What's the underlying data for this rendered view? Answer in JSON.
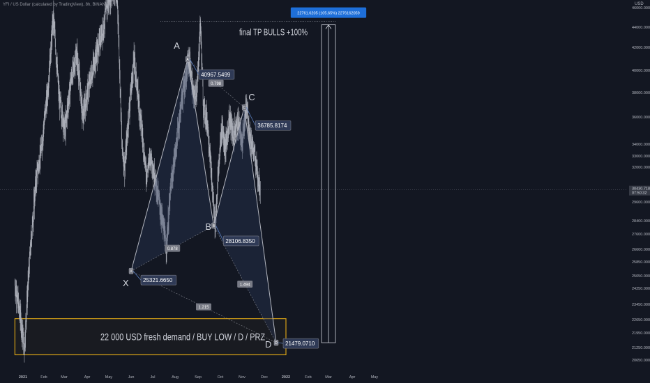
{
  "header": {
    "symbol_title": "YFI / US Dollar (calculated by TradingView), 8h, BINANCE",
    "currency": "USD"
  },
  "measure_label": "22761.6205 (105.65%) 2276162059",
  "chart_data": {
    "type": "candlestick",
    "title": "",
    "colors": {
      "background": "#131722",
      "candles": "#b2b5be",
      "pattern": "#b2b5be",
      "pattern_fill": "#2a3a5c",
      "zone_border": "#d4a017",
      "measure_label_bg": "#1e6fd9",
      "price_label_bg": "#2f3a56",
      "price_label_border": "#787b86"
    },
    "y_axis": {
      "min": 20000,
      "max": 46000,
      "ticks": [
        20650,
        21250,
        21950,
        22650,
        23450,
        24250,
        25050,
        25850,
        26600,
        27600,
        28400,
        29600,
        32000,
        33000,
        34000,
        36000,
        38000,
        40000,
        42000,
        44000,
        46000
      ],
      "tick_labels": [
        "20650.0000",
        "21250.0000",
        "21950.0000",
        "22650.0000",
        "23450.0000",
        "24250.0000",
        "25050.0000",
        "25850.0000",
        "26600.0000",
        "27600.0000",
        "28400.0000",
        "29600.0000",
        "32000.0000",
        "33000.0000",
        "34000.0000",
        "36000.0000",
        "38000.0000",
        "40000.0000",
        "42000.0000",
        "44000.0000",
        "46000.0000"
      ],
      "current_price": 30430.7183,
      "current_price_label": "30430.7183",
      "countdown_label": "07:50:32"
    },
    "x_axis": {
      "labels": [
        "2021",
        "Feb",
        "Mar",
        "Apr",
        "May",
        "Jun",
        "Jul",
        "Aug",
        "Sep",
        "Oct",
        "Nov",
        "Dec",
        "2022",
        "Feb",
        "Mar",
        "Apr",
        "May"
      ],
      "dates": [
        "2021-01-01",
        "2021-02-01",
        "2021-03-01",
        "2021-04-01",
        "2021-05-01",
        "2021-06-01",
        "2021-07-01",
        "2021-08-01",
        "2021-09-01",
        "2021-10-01",
        "2021-11-01",
        "2021-12-01",
        "2022-01-01",
        "2022-02-01",
        "2022-03-01",
        "2022-04-01",
        "2022-05-01"
      ]
    },
    "price_path": [
      [
        "2020-12-20",
        24500
      ],
      [
        "2020-12-28",
        22800
      ],
      [
        "2021-01-03",
        21200
      ],
      [
        "2021-01-10",
        25500
      ],
      [
        "2021-01-20",
        31000
      ],
      [
        "2021-01-28",
        33500
      ],
      [
        "2021-02-06",
        38000
      ],
      [
        "2021-02-14",
        45000
      ],
      [
        "2021-02-22",
        37500
      ],
      [
        "2021-03-02",
        35000
      ],
      [
        "2021-03-10",
        39000
      ],
      [
        "2021-03-18",
        41500
      ],
      [
        "2021-03-26",
        36000
      ],
      [
        "2021-04-03",
        38500
      ],
      [
        "2021-04-12",
        41000
      ],
      [
        "2021-04-22",
        43500
      ],
      [
        "2021-05-01",
        47000
      ],
      [
        "2021-05-08",
        48000
      ],
      [
        "2021-05-13",
        46500
      ],
      [
        "2021-05-19",
        34000
      ],
      [
        "2021-05-23",
        32000
      ],
      [
        "2021-05-29",
        36500
      ],
      [
        "2021-06-05",
        41000
      ],
      [
        "2021-06-10",
        38000
      ],
      [
        "2021-06-15",
        35500
      ],
      [
        "2021-06-22",
        31500
      ],
      [
        "2021-06-28",
        33000
      ],
      [
        "2021-07-05",
        31000
      ],
      [
        "2021-07-12",
        29000
      ],
      [
        "2021-07-20",
        26800
      ],
      [
        "2021-07-26",
        30500
      ],
      [
        "2021-08-02",
        33500
      ],
      [
        "2021-08-10",
        37500
      ],
      [
        "2021-08-16",
        39500
      ],
      [
        "2021-08-20",
        41000
      ],
      [
        "2021-08-26",
        37500
      ],
      [
        "2021-08-31",
        38500
      ],
      [
        "2021-09-04",
        44500
      ],
      [
        "2021-09-08",
        37000
      ],
      [
        "2021-09-14",
        35500
      ],
      [
        "2021-09-20",
        30500
      ],
      [
        "2021-09-24",
        28100
      ],
      [
        "2021-09-28",
        31500
      ],
      [
        "2021-10-03",
        35500
      ],
      [
        "2021-10-08",
        33500
      ],
      [
        "2021-10-14",
        36000
      ],
      [
        "2021-10-20",
        34500
      ],
      [
        "2021-10-26",
        35800
      ],
      [
        "2021-11-01",
        34000
      ],
      [
        "2021-11-07",
        36800
      ],
      [
        "2021-11-12",
        34500
      ],
      [
        "2021-11-18",
        33000
      ],
      [
        "2021-11-22",
        31500
      ],
      [
        "2021-11-26",
        30400
      ]
    ],
    "pattern": {
      "name": "XABCD",
      "points": [
        {
          "label": "X",
          "date": "2021-06-01",
          "price": 25321.665,
          "price_label": "25321.6650"
        },
        {
          "label": "A",
          "date": "2021-08-18",
          "price": 40967.5499,
          "price_label": "40967.5499"
        },
        {
          "label": "B",
          "date": "2021-09-22",
          "price": 28106.835,
          "price_label": "28106.8350"
        },
        {
          "label": "C",
          "date": "2021-11-04",
          "price": 36785.8174,
          "price_label": "36785.8174"
        },
        {
          "label": "D",
          "date": "2021-12-18",
          "price": 21479.071,
          "price_label": "21479.0710"
        }
      ],
      "ratios": [
        {
          "from": "X",
          "to": "B",
          "value": "0.878"
        },
        {
          "from": "A",
          "to": "C",
          "value": "0.798"
        },
        {
          "from": "B",
          "to": "D",
          "value": "1.494"
        },
        {
          "from": "X",
          "to": "D",
          "value": "1.215"
        }
      ]
    },
    "annotations": {
      "tp_text": "final TP BULLS +100%",
      "zone_text": "22 000 USD fresh demand / BUY LOW / D / PRZ",
      "zone": {
        "date_start": "2020-12-20",
        "date_end": "2022-01-01",
        "price_low": 20900,
        "price_high": 22700
      },
      "measure": {
        "date": "2022-03-01",
        "price_low": 21479.071,
        "price_high": 44240
      }
    }
  }
}
